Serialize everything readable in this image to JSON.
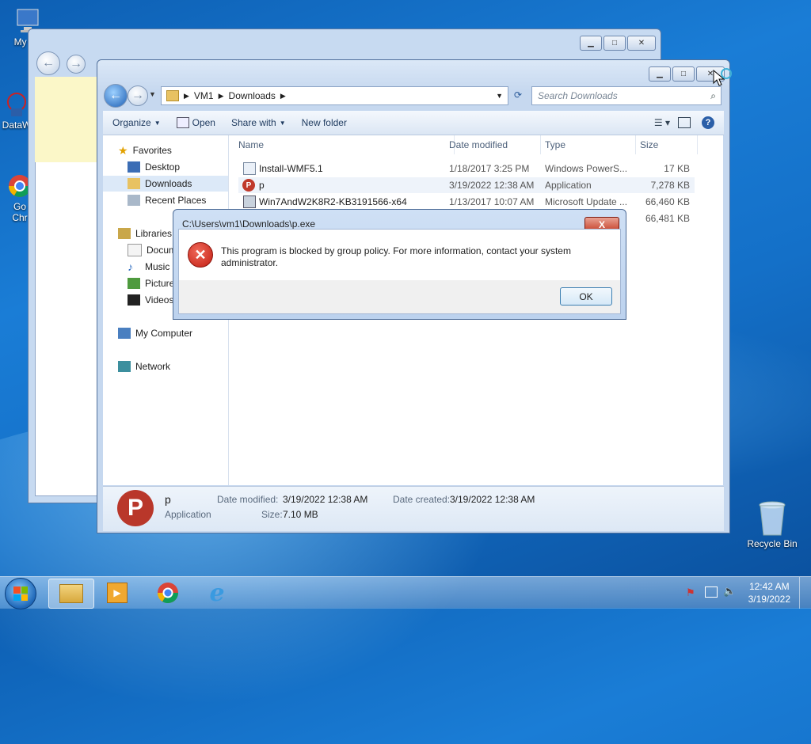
{
  "desktop": {
    "icons": [
      {
        "label": "My Co",
        "icon": "computer-icon"
      },
      {
        "label": "DataW",
        "icon": "datawiper-icon"
      },
      {
        "label": "Go",
        "label2": "Chr",
        "icon": "chrome-shortcut-icon"
      },
      {
        "label": "Recycle Bin",
        "icon": "recycle-bin-icon"
      }
    ]
  },
  "explorer": {
    "breadcrumb": [
      "VM1",
      "Downloads"
    ],
    "search_placeholder": "Search Downloads",
    "toolbar": {
      "organize": "Organize",
      "open": "Open",
      "share_with": "Share with",
      "new_folder": "New folder"
    },
    "nav": {
      "favorites": "Favorites",
      "desktop": "Desktop",
      "downloads": "Downloads",
      "recent": "Recent Places",
      "libraries": "Libraries",
      "documents": "Docum",
      "music": "Music",
      "pictures": "Picture",
      "videos": "Videos",
      "computer": "My Computer",
      "network": "Network"
    },
    "columns": {
      "name": "Name",
      "date": "Date modified",
      "type": "Type",
      "size": "Size"
    },
    "files": [
      {
        "name": "Install-WMF5.1",
        "date": "1/18/2017 3:25 PM",
        "type": "Windows PowerS...",
        "size": "17 KB"
      },
      {
        "name": "p",
        "date": "3/19/2022 12:38 AM",
        "type": "Application",
        "size": "7,278 KB"
      },
      {
        "name": "Win7AndW2K8R2-KB3191566-x64",
        "date": "1/13/2017 10:07 AM",
        "type": "Microsoft Update ...",
        "size": "66,460 KB"
      },
      {
        "name": "",
        "date": "",
        "type": "",
        "size": "66,481 KB"
      }
    ],
    "details": {
      "name": "p",
      "type": "Application",
      "modified_label": "Date modified:",
      "modified": "3/19/2022 12:38 AM",
      "created_label": "Date created:",
      "created": "3/19/2022 12:38 AM",
      "size_label": "Size:",
      "size": "7.10 MB"
    }
  },
  "dialog": {
    "title": "C:\\Users\\vm1\\Downloads\\p.exe",
    "message": "This program is blocked by group policy. For more information, contact your system administrator.",
    "ok": "OK",
    "close": "X"
  },
  "taskbar": {
    "time": "12:42 AM",
    "date": "3/19/2022"
  }
}
